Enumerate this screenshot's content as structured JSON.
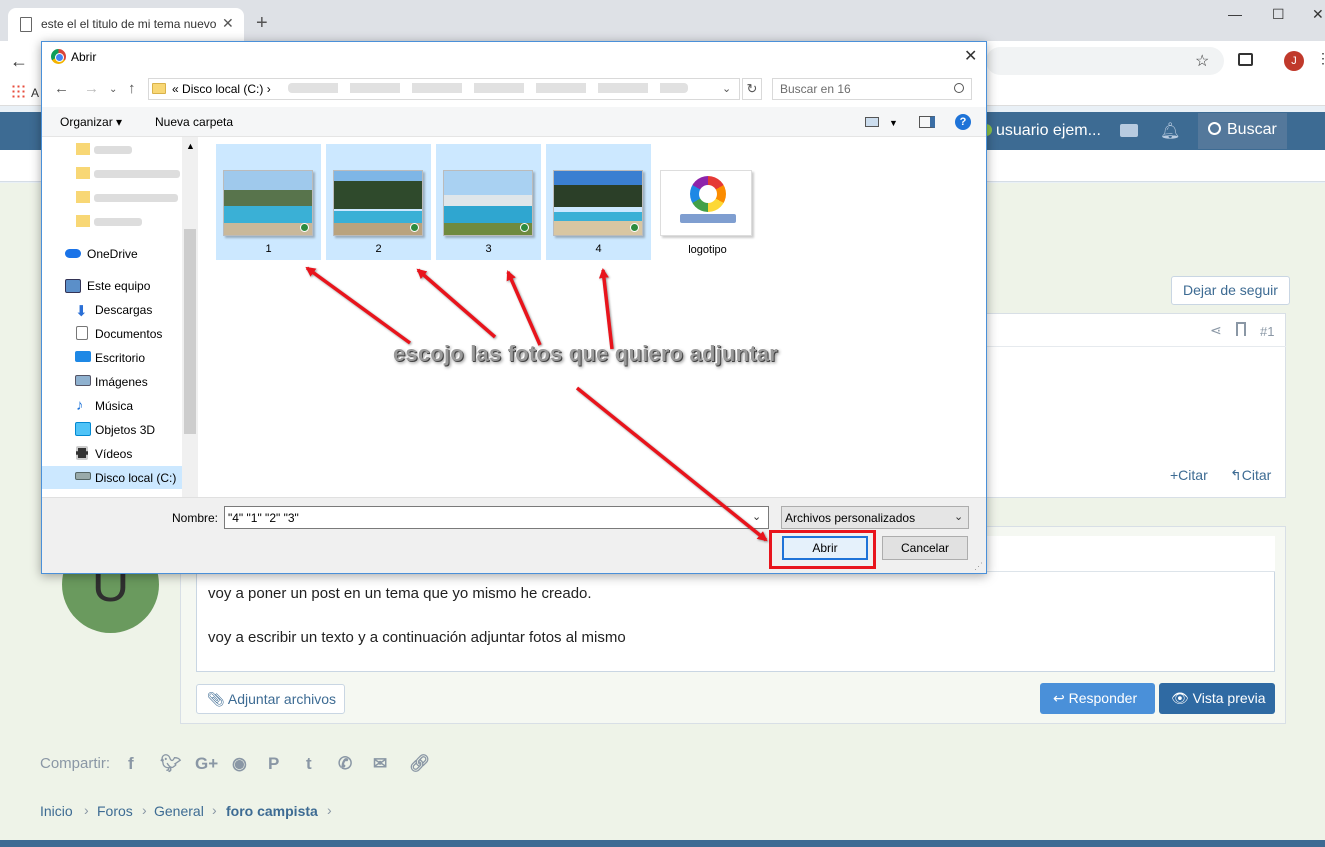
{
  "browser": {
    "tab_title": "este el el titulo de mi tema nuevo",
    "new_tab_symbol": "+",
    "bookmarks_label": "A",
    "avatar_initial": "J"
  },
  "forum": {
    "username": "usuario ejem...",
    "search_label": "Buscar",
    "unfollow_label": "Dejar de seguir",
    "post_number": "#1",
    "quote_labels": [
      "+Citar",
      "Citar"
    ],
    "reply_avatar_initial": "U",
    "editor_lines": [
      "voy a poner un post en un tema que yo mismo he creado.",
      "voy a escribir  un texto y a continuación adjuntar fotos al mismo"
    ],
    "attach_label": "Adjuntar archivos",
    "reply_label": "Responder",
    "preview_label": "Vista previa",
    "share_label": "Compartir:",
    "share_icons": [
      "facebook-icon",
      "twitter-icon",
      "google-plus-icon",
      "reddit-icon",
      "pinterest-icon",
      "tumblr-icon",
      "whatsapp-icon",
      "email-icon",
      "link-icon"
    ],
    "breadcrumbs": [
      "Inicio",
      "Foros",
      "General",
      "foro campista"
    ]
  },
  "dialog": {
    "title": "Abrir",
    "address_prefix": "«",
    "address_root": "Disco local (C:)",
    "address_chevron": "›",
    "search_placeholder": "Buscar en 16",
    "organize_label": "Organizar ▾",
    "new_folder_label": "Nueva carpeta",
    "help_symbol": "?",
    "nav_items": [
      {
        "label": "OneDrive",
        "icon": "onedrive-icon"
      },
      {
        "label": "Este equipo",
        "icon": "computer-icon"
      },
      {
        "label": "Descargas",
        "icon": "downloads-icon"
      },
      {
        "label": "Documentos",
        "icon": "documents-icon"
      },
      {
        "label": "Escritorio",
        "icon": "desktop-icon"
      },
      {
        "label": "Imágenes",
        "icon": "pictures-icon"
      },
      {
        "label": "Música",
        "icon": "music-icon"
      },
      {
        "label": "Objetos 3D",
        "icon": "3d-objects-icon"
      },
      {
        "label": "Vídeos",
        "icon": "videos-icon"
      },
      {
        "label": "Disco local (C:)",
        "icon": "drive-icon"
      }
    ],
    "files": [
      {
        "label": "1",
        "selected": true
      },
      {
        "label": "2",
        "selected": true
      },
      {
        "label": "3",
        "selected": true
      },
      {
        "label": "4",
        "selected": true
      },
      {
        "label": "logotipo",
        "selected": false
      }
    ],
    "name_label": "Nombre:",
    "name_value": "\"4\" \"1\" \"2\" \"3\"",
    "type_value": "Archivos personalizados",
    "open_label": "Abrir",
    "cancel_label": "Cancelar"
  },
  "annotation": {
    "text": "escojo las fotos que quiero adjuntar",
    "color": "#e8141c"
  }
}
